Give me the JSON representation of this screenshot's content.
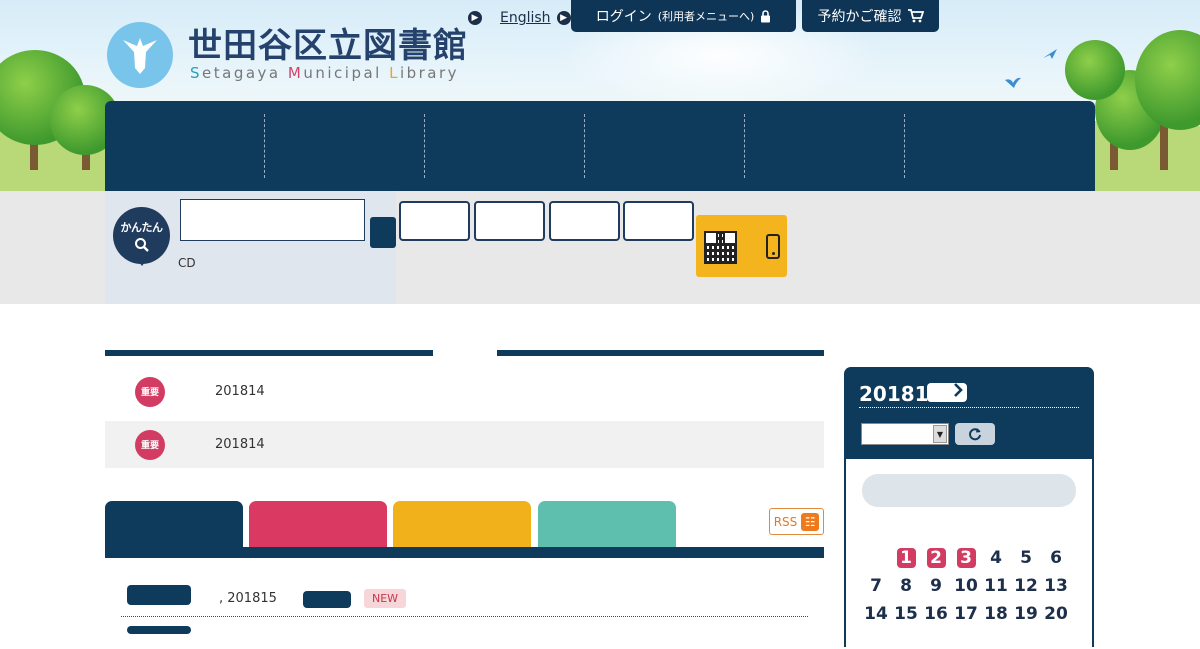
{
  "header": {
    "title": "世田谷区立図書館",
    "subtitle_parts": [
      {
        "cls": "c1",
        "text": "S"
      },
      {
        "cls": "",
        "text": "etagaya "
      },
      {
        "cls": "c2",
        "text": "M"
      },
      {
        "cls": "",
        "text": "unicipal "
      },
      {
        "cls": "c3",
        "text": "L"
      },
      {
        "cls": "",
        "text": "ibrary"
      }
    ],
    "english_link": "English",
    "login_label": "ログイン",
    "login_sub": "(利用者メニューへ)",
    "cart_label": "予約かご確認"
  },
  "search": {
    "kantan_label": "かんたん",
    "cd_label": "CD",
    "input_value": ""
  },
  "notices": [
    {
      "badge": "重要",
      "date": "201814"
    },
    {
      "badge": "重要",
      "date": "201814"
    }
  ],
  "tabs": {
    "colors": [
      "#0e3a5b",
      "#da3a62",
      "#f1b11b",
      "#5fbfae"
    ]
  },
  "rss_label": "RSS",
  "news": {
    "date": ", 201815",
    "new_label": "NEW"
  },
  "calendar": {
    "title": "20181",
    "highlighted": [
      1,
      2,
      3
    ],
    "days": [
      "",
      "1",
      "2",
      "3",
      "4",
      "5",
      "6",
      "7",
      "8",
      "9",
      "10",
      "11",
      "12",
      "13",
      "14",
      "15",
      "16",
      "17",
      "18",
      "19",
      "20"
    ]
  }
}
